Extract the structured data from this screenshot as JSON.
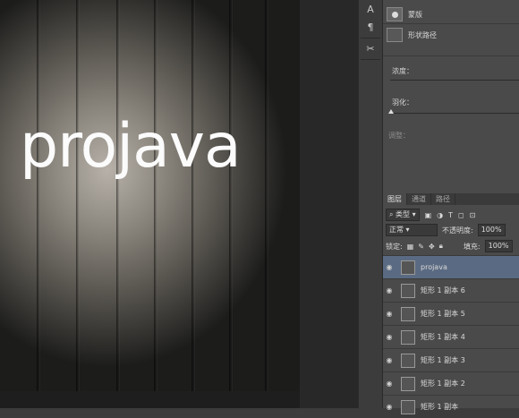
{
  "canvas": {
    "text": "projava"
  },
  "tools": {
    "icons": [
      "text-tool-icon",
      "paragraph-icon",
      "tools-icon"
    ]
  },
  "properties": {
    "mask_label": "蒙版",
    "shape_path_label": "形状路径",
    "density_label": "浓度：",
    "feather_label": "羽化：",
    "adjust_label": "调整："
  },
  "layers_panel": {
    "tabs": [
      "图层",
      "通道",
      "路径"
    ],
    "filter": "类型",
    "blend_mode": "正常",
    "opacity_label": "不透明度:",
    "opacity_value": "100%",
    "lock_label": "锁定:",
    "fill_label": "填充:",
    "fill_value": "100%",
    "layers": [
      {
        "name": "projava",
        "selected": true
      },
      {
        "name": "矩形 1 副本 6",
        "selected": false
      },
      {
        "name": "矩形 1 副本 5",
        "selected": false
      },
      {
        "name": "矩形 1 副本 4",
        "selected": false
      },
      {
        "name": "矩形 1 副本 3",
        "selected": false
      },
      {
        "name": "矩形 1 副本 2",
        "selected": false
      },
      {
        "name": "矩形 1 副本",
        "selected": false
      }
    ]
  }
}
